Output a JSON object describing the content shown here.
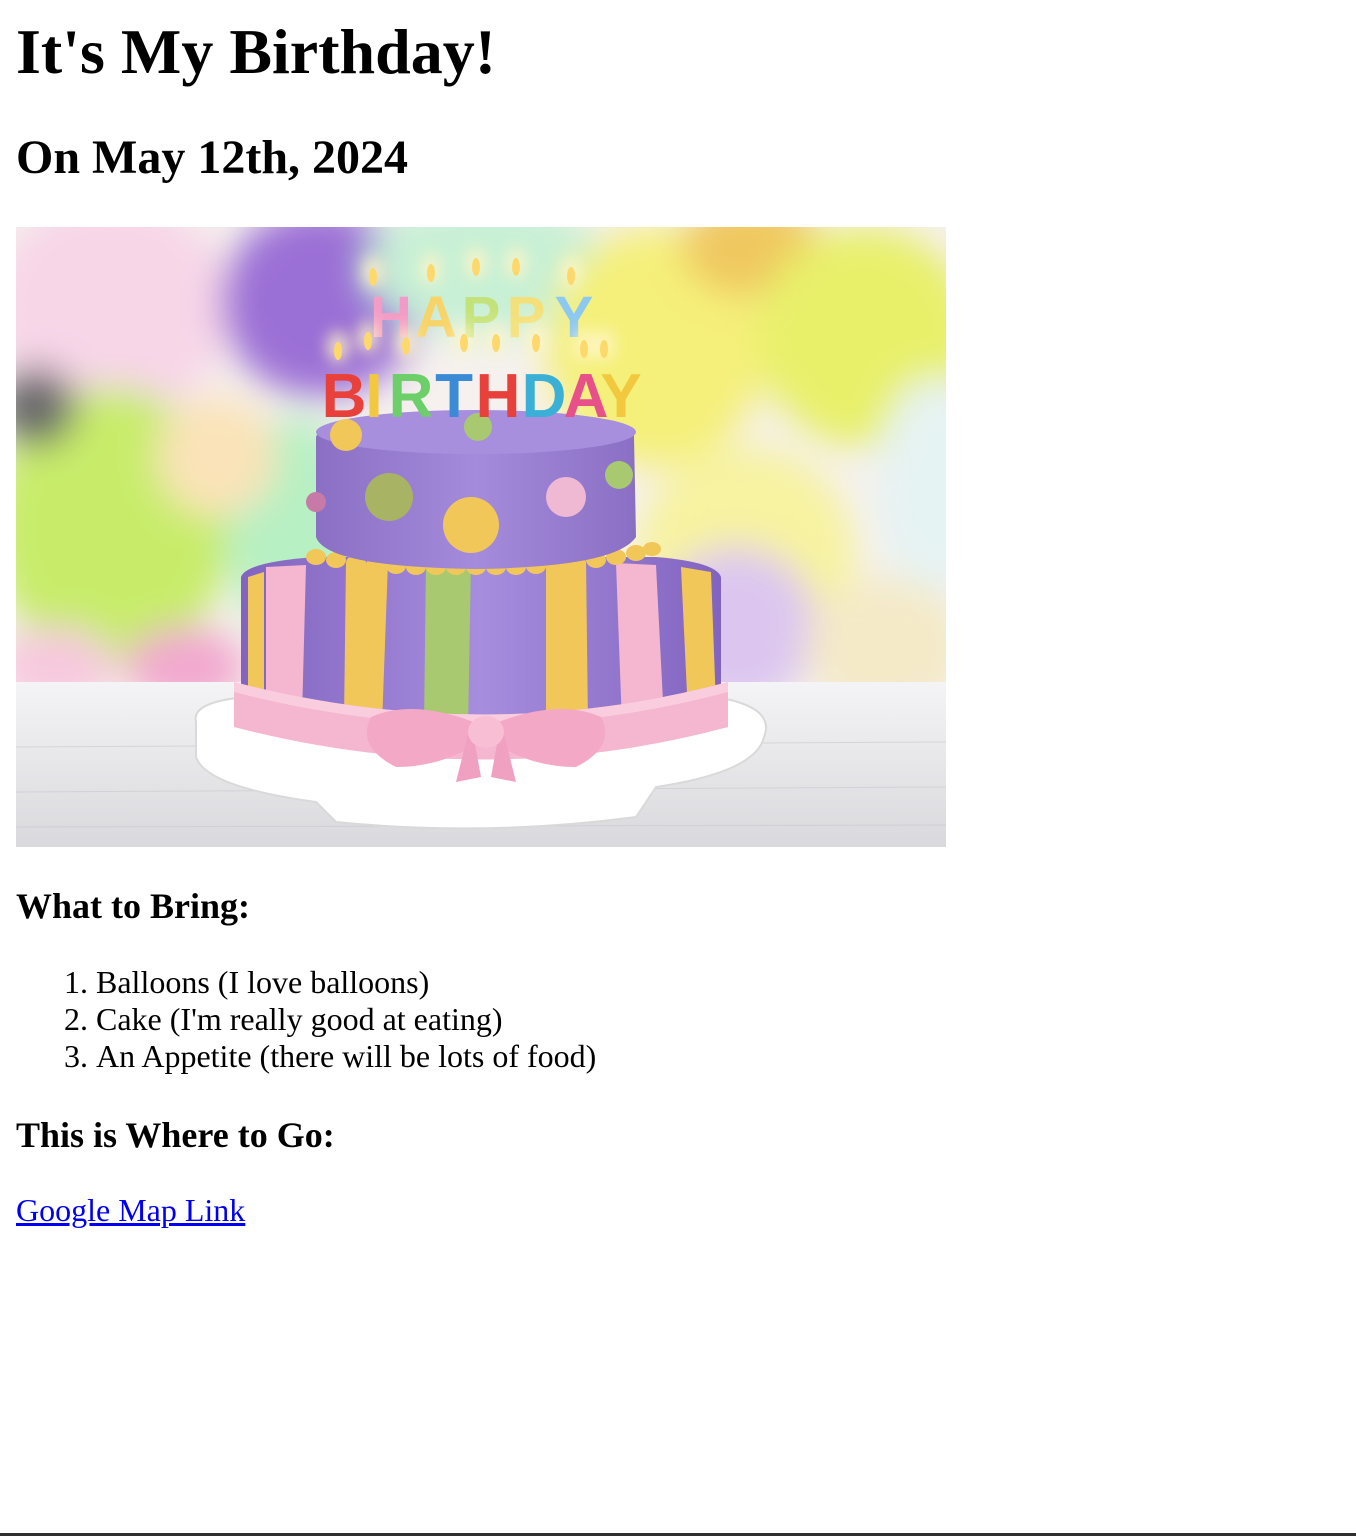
{
  "page": {
    "title": "It's My Birthday!",
    "date_heading": "On May 12th, 2024"
  },
  "hero_image": {
    "semantic": "birthday-cake-photo",
    "candle_top_word": "HAPPY",
    "candle_bottom_word": "BIRTHDAY"
  },
  "bring": {
    "heading": "What to Bring:",
    "items": [
      {
        "number": "1.",
        "text": "Balloons (I love balloons)"
      },
      {
        "number": "2.",
        "text": "Cake (I'm really good at eating)"
      },
      {
        "number": "3.",
        "text": "An Appetite (there will be lots of food)"
      }
    ]
  },
  "where": {
    "heading": "This is Where to Go:",
    "link_label": "Google Map Link"
  },
  "colors": {
    "link": "#0000ee",
    "cake_purple": "#9a7fd0",
    "ribbon_pink": "#f5b6cf",
    "stripe_yellow": "#f2c75a",
    "stripe_green": "#a8c96f"
  }
}
